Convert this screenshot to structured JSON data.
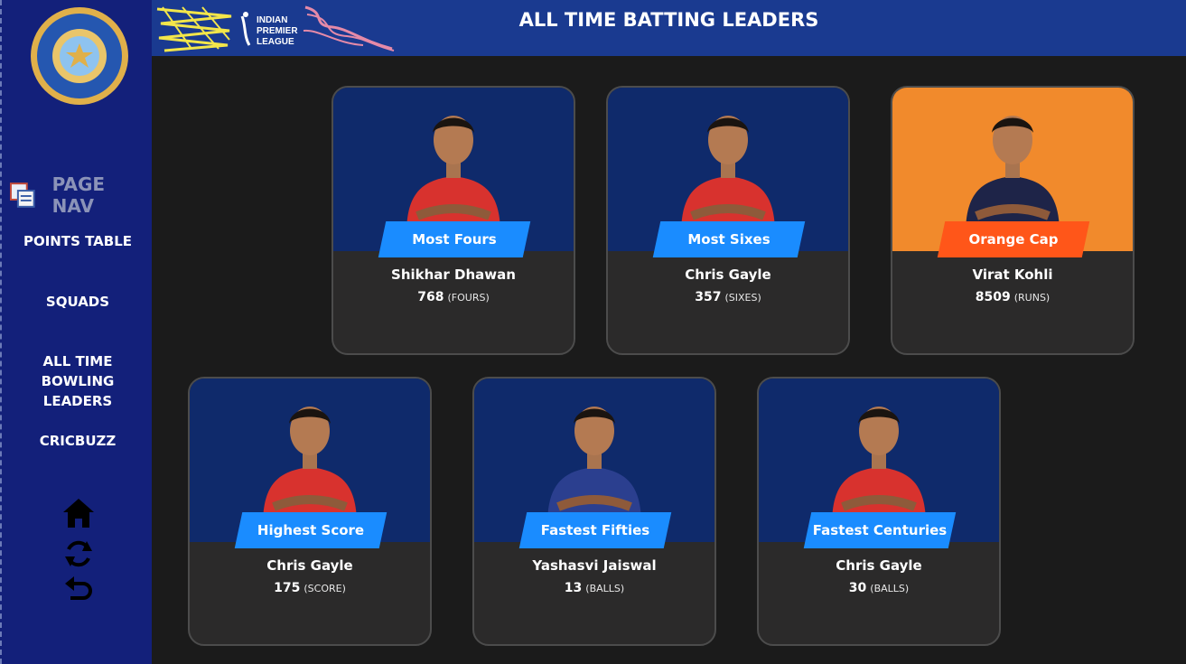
{
  "header": {
    "title": "ALL TIME BATTING LEADERS",
    "banner_text": [
      "INDIAN",
      "PREMIER",
      "LEAGUE"
    ]
  },
  "sidebar": {
    "pagenav_label": "PAGE NAV",
    "items": [
      {
        "label": "POINTS TABLE"
      },
      {
        "label": "SQUADS"
      },
      {
        "label": "ALL TIME BOWLING LEADERS"
      },
      {
        "label": "CRICBUZZ"
      }
    ],
    "icons": [
      "home-icon",
      "refresh-icon",
      "back-icon"
    ]
  },
  "cards": [
    {
      "category": "Most Fours",
      "player": "Shikhar Dhawan",
      "value": "768",
      "unit": "(FOURS)",
      "jersey": "#d8322e",
      "theme": "blue"
    },
    {
      "category": "Most Sixes",
      "player": "Chris Gayle",
      "value": "357",
      "unit": "(SIXES)",
      "jersey": "#d8322e",
      "theme": "blue"
    },
    {
      "category": "Orange Cap",
      "player": "Virat Kohli",
      "value": "8509",
      "unit": "(RUNS)",
      "jersey": "#1e2448",
      "theme": "orange"
    },
    {
      "category": "Highest Score",
      "player": "Chris Gayle",
      "value": "175",
      "unit": "(SCORE)",
      "jersey": "#d8322e",
      "theme": "blue"
    },
    {
      "category": "Fastest Fifties",
      "player": "Yashasvi Jaiswal",
      "value": "13",
      "unit": "(BALLS)",
      "jersey": "#2b3f8f",
      "theme": "blue"
    },
    {
      "category": "Fastest Centuries",
      "player": "Chris Gayle",
      "value": "30",
      "unit": "(BALLS)",
      "jersey": "#d8322e",
      "theme": "blue"
    }
  ],
  "colors": {
    "sidebar": "#13207a",
    "header": "#1a3a90",
    "tag_blue": "#1a8cff",
    "tag_orange": "#ff5619",
    "card_orange": "#f18a2c"
  }
}
